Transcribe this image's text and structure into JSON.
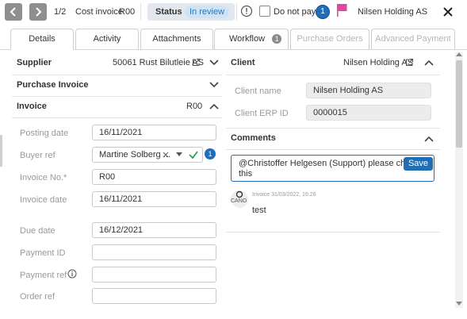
{
  "topbar": {
    "counter": "1/2",
    "doc_title": "Cost invoice",
    "doc_number": "R00",
    "status_label": "Status",
    "status_value": "In review",
    "do_not_pay_label": "Do not pay",
    "notification_count": "1",
    "company": "Nilsen Holding AS"
  },
  "tabs": [
    {
      "label": "Details"
    },
    {
      "label": "Activity"
    },
    {
      "label": "Attachments"
    },
    {
      "label": "Workflow",
      "badge": "1"
    },
    {
      "label": "Purchase Orders"
    },
    {
      "label": "Advanced Payment"
    }
  ],
  "left": {
    "supplier": {
      "label": "Supplier",
      "value": "50061 Rust Bilutleie AS"
    },
    "purchase_invoice": {
      "label": "Purchase Invoice"
    },
    "invoice": {
      "label": "Invoice",
      "value": "R00"
    },
    "fields": {
      "posting_date": {
        "label": "Posting date",
        "value": "16/11/2021"
      },
      "buyer_ref": {
        "label": "Buyer ref",
        "value": "Martine Solberg ..."
      },
      "invoice_no": {
        "label": "Invoice No.*",
        "value": "R00"
      },
      "invoice_date": {
        "label": "Invoice date",
        "value": "16/11/2021"
      },
      "due_date": {
        "label": "Due date",
        "value": "16/12/2021"
      },
      "payment_id": {
        "label": "Payment ID",
        "value": ""
      },
      "payment_ref": {
        "label": "Payment ref",
        "value": ""
      },
      "order_ref": {
        "label": "Order ref",
        "value": ""
      }
    }
  },
  "right": {
    "client": {
      "label": "Client",
      "value": "Nilsen Holding AS"
    },
    "client_name": {
      "label": "Client name",
      "value": "Nilsen Holding AS"
    },
    "client_erp": {
      "label": "Client ERP ID",
      "value": "0000015"
    },
    "comments": {
      "label": "Comments",
      "draft_line1": "@Christoffer Helgesen (Support)  please check",
      "draft_line2": "this",
      "save_label": "Save",
      "entry": {
        "avatar": "CANO",
        "meta": "Invoice  31/03/2022, 16:26",
        "text": "test"
      }
    }
  },
  "colors": {
    "accent": "#1f6fb8",
    "pink": "#e0479e",
    "tag_bg": "#cfe3f5"
  }
}
